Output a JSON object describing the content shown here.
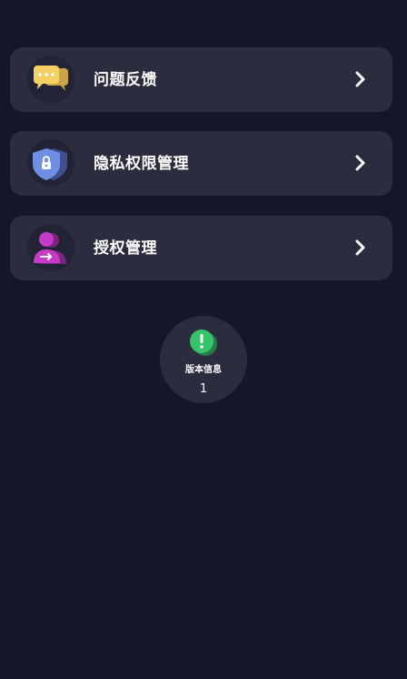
{
  "menu": {
    "items": [
      {
        "label": "问题反馈",
        "icon": "chat-bubbles-icon"
      },
      {
        "label": "隐私权限管理",
        "icon": "shield-lock-icon"
      },
      {
        "label": "授权管理",
        "icon": "user-authorize-icon"
      }
    ]
  },
  "version": {
    "title": "版本信息",
    "number": "1",
    "icon": "exclamation-icon"
  },
  "colors": {
    "background": "#151628",
    "card": "#2b2c3e",
    "feedback_icon": "#f5d064",
    "privacy_icon": "#6f8fe6",
    "auth_icon": "#c63cc9",
    "version_icon": "#36c46a"
  }
}
